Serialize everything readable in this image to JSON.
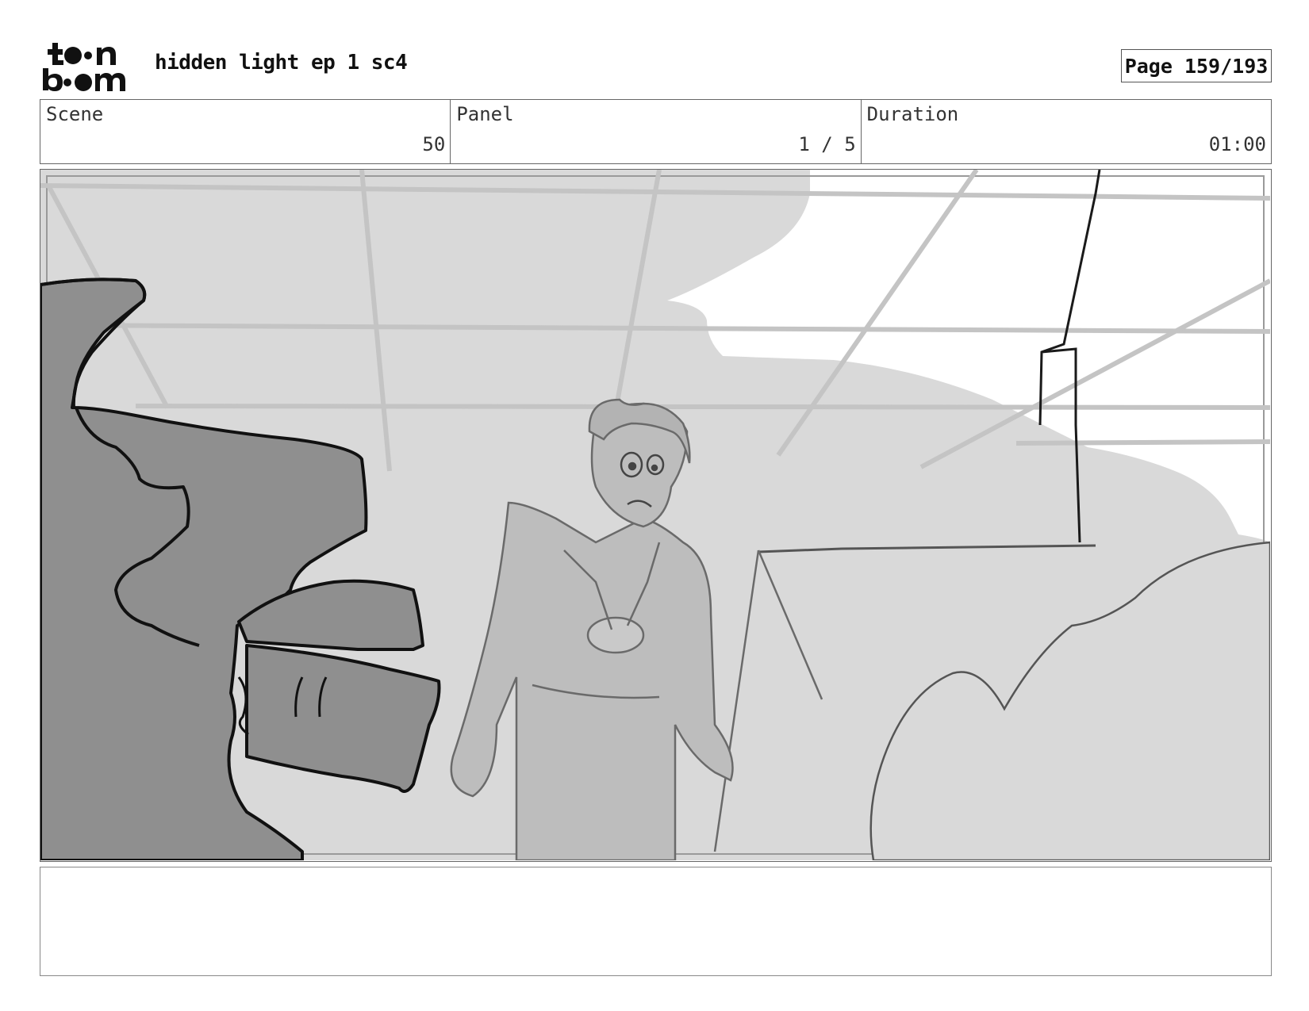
{
  "header": {
    "logo_alt": "toon boom",
    "project_title": "hidden light ep 1 sc4",
    "page_label": "Page 159/193"
  },
  "info": {
    "scene_label": "Scene",
    "scene_value": "50",
    "panel_label": "Panel",
    "panel_value": "1 / 5",
    "duration_label": "Duration",
    "duration_value": "01:00"
  },
  "panel_image": {
    "description_icon": "storyboard-sketch"
  },
  "notes": {
    "text": ""
  }
}
